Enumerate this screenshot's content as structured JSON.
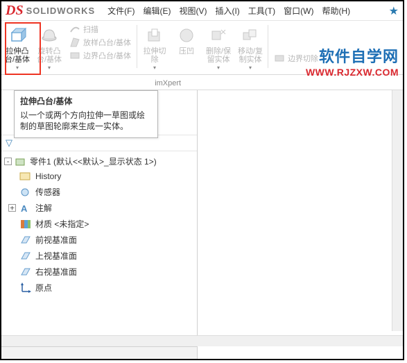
{
  "app": {
    "logo_text": "SOLIDWORKS"
  },
  "menus": {
    "file": "文件(F)",
    "edit": "编辑(E)",
    "view": "视图(V)",
    "insert": "插入(I)",
    "tools": "工具(T)",
    "window": "窗口(W)",
    "help": "帮助(H)"
  },
  "ribbon": {
    "extrude": "拉伸凸\n台/基体",
    "revolve": "旋转凸\n台/基体",
    "sweep": "扫描",
    "loft": "放样凸台/基体",
    "boundary": "边界凸台/基体",
    "extrude_cut": "拉伸切\n除",
    "press": "压凹",
    "delete_keep": "删除/保\n留实体",
    "move_copy": "移动/复\n制实体",
    "boundary_cut": "边界切除"
  },
  "tabs": {
    "t4": "imXpert"
  },
  "tooltip": {
    "title": "拉伸凸台/基体",
    "body": "以一个或两个方向拉伸一草图或绘制的草图轮廓来生成一实体。"
  },
  "tree": {
    "root": "零件1  (默认<<默认>_显示状态 1>)",
    "history": "History",
    "sensor": "传感器",
    "annotation": "注解",
    "material": "材质 <未指定>",
    "front": "前视基准面",
    "top": "上视基准面",
    "right": "右视基准面",
    "origin": "原点"
  },
  "watermark": {
    "line1": "软件自学网",
    "line2": "WWW.RJZXW.COM"
  }
}
